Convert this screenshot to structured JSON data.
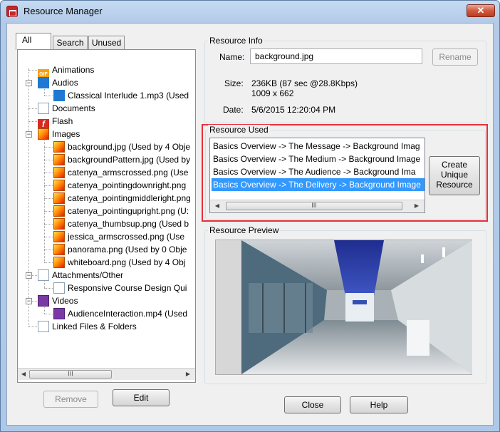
{
  "window": {
    "title": "Resource Manager",
    "close_glyph": "✕"
  },
  "tabs": [
    {
      "label": "All"
    },
    {
      "label": "Search"
    },
    {
      "label": "Unused"
    }
  ],
  "tree": {
    "animations": "Animations",
    "audios": "Audios",
    "audio_file": "Classical Interlude 1.mp3 (Used",
    "documents": "Documents",
    "flash": "Flash",
    "images": "Images",
    "image_files": [
      "background.jpg (Used by 4 Obje",
      "backgroundPattern.jpg (Used by",
      "catenya_armscrossed.png (Use",
      "catenya_pointingdownright.png",
      "catenya_pointingmiddleright.png",
      "catenya_pointingupright.png (U:",
      "catenya_thumbsup.png (Used b",
      "jessica_armscrossed.png (Use",
      "panorama.png (Used by 0 Obje",
      "whiteboard.png (Used by 4 Obj"
    ],
    "attachments": "Attachments/Other",
    "attachment_file": "Responsive Course Design Qui",
    "videos": "Videos",
    "video_file": "AudienceInteraction.mp4 (Used",
    "linked": "Linked Files & Folders",
    "gif_badge": "GIF",
    "flash_badge": "f"
  },
  "scroll": {
    "left": "◀",
    "right": "▶",
    "grip": "III"
  },
  "left_buttons": {
    "remove": "Remove",
    "edit": "Edit"
  },
  "resource_info": {
    "title": "Resource Info",
    "name_label": "Name:",
    "name_value": "background.jpg",
    "rename": "Rename",
    "size_label": "Size:",
    "size_value": "236KB (87 sec @28.8Kbps)",
    "dimensions": "1009 x 662",
    "date_label": "Date:",
    "date_value": "5/6/2015 12:20:04 PM"
  },
  "resource_used": {
    "title": "Resource Used",
    "items": [
      "Basics Overview -> The Message -> Background Imag",
      "Basics Overview -> The Medium -> Background Image",
      "Basics Overview -> The Audience -> Background Ima",
      "Basics Overview -> The Delivery -> Background Image"
    ],
    "create_line1": "Create",
    "create_line2": "Unique",
    "create_line3": "Resource"
  },
  "resource_preview": {
    "title": "Resource Preview"
  },
  "bottom_buttons": {
    "close": "Close",
    "help": "Help"
  }
}
